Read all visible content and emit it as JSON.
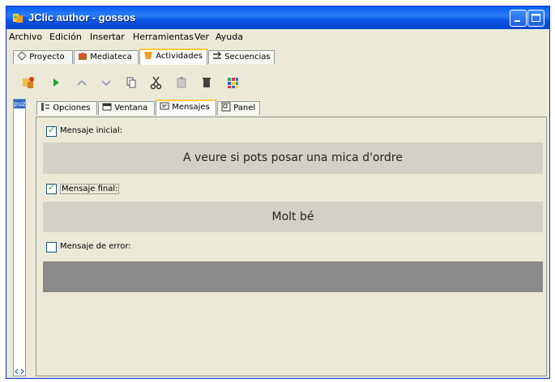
{
  "window": {
    "title": "JClic author - gossos"
  },
  "menu": [
    "Archivo",
    "Edición",
    "Insertar",
    "Herramientas",
    "Ver",
    "Ayuda"
  ],
  "main_tabs": [
    {
      "label": "Proyecto",
      "icon": "project-icon"
    },
    {
      "label": "Mediateca",
      "icon": "mediateca-icon"
    },
    {
      "label": "Actividades",
      "icon": "activities-icon",
      "active": true
    },
    {
      "label": "Secuencias",
      "icon": "sequences-icon"
    }
  ],
  "toolbar_icons": [
    "new-activity-icon",
    "play-icon",
    "move-up-icon",
    "move-down-icon",
    "copy-icon",
    "cut-icon",
    "paste-icon",
    "delete-icon",
    "grid-icon"
  ],
  "activity_list": {
    "selected": "puzz"
  },
  "sub_tabs": [
    {
      "label": "Opciones",
      "icon": "options-icon"
    },
    {
      "label": "Ventana",
      "icon": "window-icon"
    },
    {
      "label": "Mensajes",
      "icon": "messages-icon",
      "active": true
    },
    {
      "label": "Panel",
      "icon": "panel-icon"
    }
  ],
  "messages": {
    "initial": {
      "label": "Mensaje inicial:",
      "checked": true,
      "text": "A veure si pots posar una mica d'ordre"
    },
    "final": {
      "label": "Mensaje final:",
      "checked": true,
      "text": "Molt bé"
    },
    "error": {
      "label": "Mensaje de error:",
      "checked": false,
      "text": ""
    }
  },
  "colors": {
    "title_bar": "#0a5ef0",
    "active_tab_accent": "#ffc83c",
    "message_bg": "#d4d0c8",
    "error_message_bg": "#8a8a8a"
  }
}
